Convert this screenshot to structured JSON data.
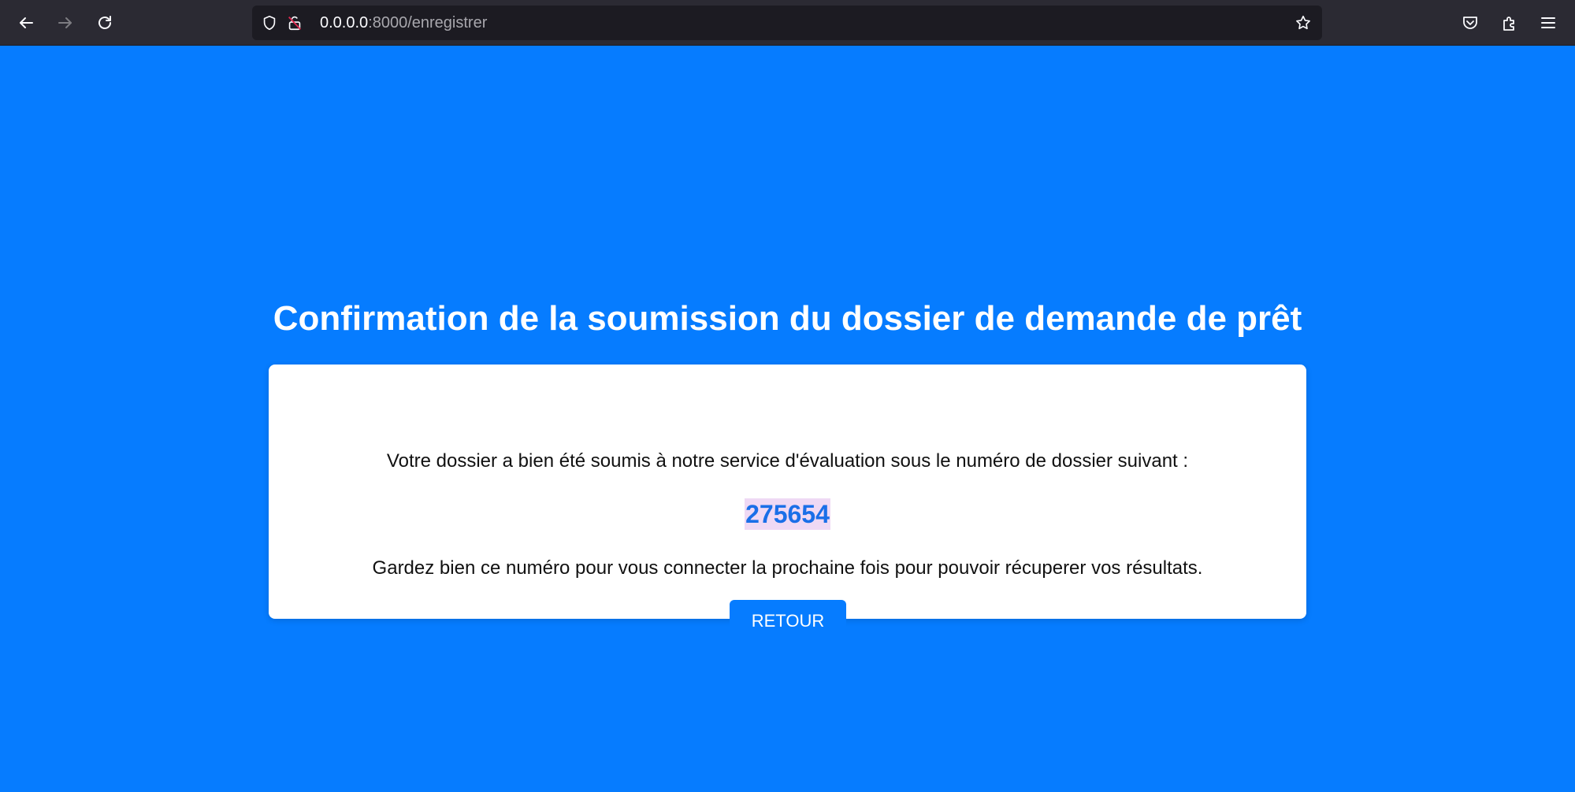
{
  "browser": {
    "url_host": "0.0.0.0",
    "url_path": ":8000/enregistrer",
    "icons": {
      "back": "back-arrow-icon",
      "forward": "forward-arrow-icon",
      "reload": "reload-icon",
      "shield": "shield-icon",
      "insecure": "insecure-lock-icon",
      "bookmark": "star-icon",
      "pocket": "pocket-icon",
      "extensions": "extensions-icon",
      "menu": "hamburger-menu-icon"
    },
    "colors": {
      "toolbar_bg": "#2b2a33",
      "urlbar_bg": "#1c1b22",
      "insecure_accent": "#e22850"
    }
  },
  "page": {
    "title": "Confirmation de la soumission du dossier de demande de prêt",
    "message_intro": "Votre dossier a bien été soumis à notre service d'évaluation sous le numéro de dossier suivant :",
    "dossier_number": "275654",
    "message_keep": "Gardez bien ce numéro pour vous connecter la prochaine fois pour pouvoir récuperer vos résultats.",
    "back_button_label": "RETOUR",
    "colors": {
      "background": "#067cff",
      "card": "#ffffff",
      "number_text": "#1a6fe8",
      "number_highlight": "#efd9f4",
      "button": "#067cff"
    }
  }
}
